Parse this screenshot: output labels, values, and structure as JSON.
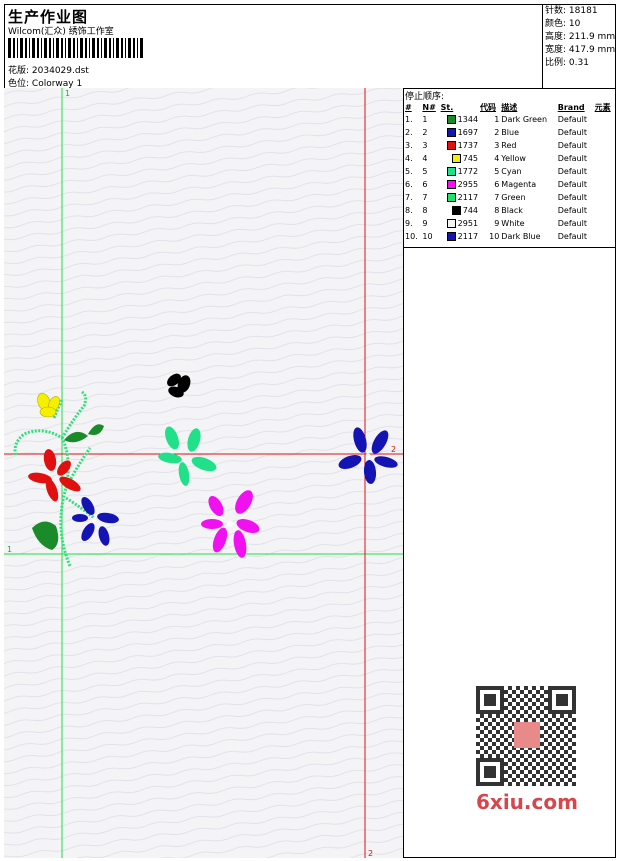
{
  "header": {
    "title": "生产作业图",
    "company": "Wilcom(汇众) 绣饰工作室",
    "pattern_label": "花版:",
    "pattern_value": "2034029.dst",
    "colorway_label": "色位:",
    "colorway_value": "Colorway 1"
  },
  "stats": [
    {
      "label": "针数:",
      "value": "18181"
    },
    {
      "label": "颜色:",
      "value": "10"
    },
    {
      "label": "高度:",
      "value": "211.9 mm"
    },
    {
      "label": "宽度:",
      "value": "417.9 mm"
    },
    {
      "label": "比例:",
      "value": "0.31"
    }
  ],
  "stop_sequence": {
    "title": "停止顺序:",
    "headers": [
      "#",
      "N#",
      "St.",
      "代码",
      "描述",
      "Brand",
      "元素"
    ],
    "rows": [
      {
        "idx": "1.",
        "n": "1",
        "color": "#1a8a2a",
        "st": "1344",
        "code": "1",
        "desc": "Dark Green",
        "brand": "Default"
      },
      {
        "idx": "2.",
        "n": "2",
        "color": "#1414b4",
        "st": "1697",
        "code": "2",
        "desc": "Blue",
        "brand": "Default"
      },
      {
        "idx": "3.",
        "n": "3",
        "color": "#e01010",
        "st": "1737",
        "code": "3",
        "desc": "Red",
        "brand": "Default"
      },
      {
        "idx": "4.",
        "n": "4",
        "color": "#f5f000",
        "st": "745",
        "code": "4",
        "desc": "Yellow",
        "brand": "Default"
      },
      {
        "idx": "5.",
        "n": "5",
        "color": "#22e08a",
        "st": "1772",
        "code": "5",
        "desc": "Cyan",
        "brand": "Default"
      },
      {
        "idx": "6.",
        "n": "6",
        "color": "#f010f0",
        "st": "2955",
        "code": "6",
        "desc": "Magenta",
        "brand": "Default"
      },
      {
        "idx": "7.",
        "n": "7",
        "color": "#22e06a",
        "st": "2117",
        "code": "7",
        "desc": "Green",
        "brand": "Default"
      },
      {
        "idx": "8.",
        "n": "8",
        "color": "#000000",
        "st": "744",
        "code": "8",
        "desc": "Black",
        "brand": "Default"
      },
      {
        "idx": "9.",
        "n": "9",
        "color": "#f4f4f4",
        "st": "2951",
        "code": "9",
        "desc": "White",
        "brand": "Default"
      },
      {
        "idx": "10.",
        "n": "10",
        "color": "#1414b4",
        "st": "2117",
        "code": "10",
        "desc": "Dark Blue",
        "brand": "Default"
      }
    ]
  },
  "guides": {
    "green_top_label": "1",
    "green_left_label": "1",
    "red_right_label": "2",
    "red_bottom_label": "2"
  },
  "watermark": "6xiu.com",
  "colors": {
    "guide_green": "#22dd44",
    "guide_red": "#e01010",
    "stem_green": "#2ee07a"
  }
}
